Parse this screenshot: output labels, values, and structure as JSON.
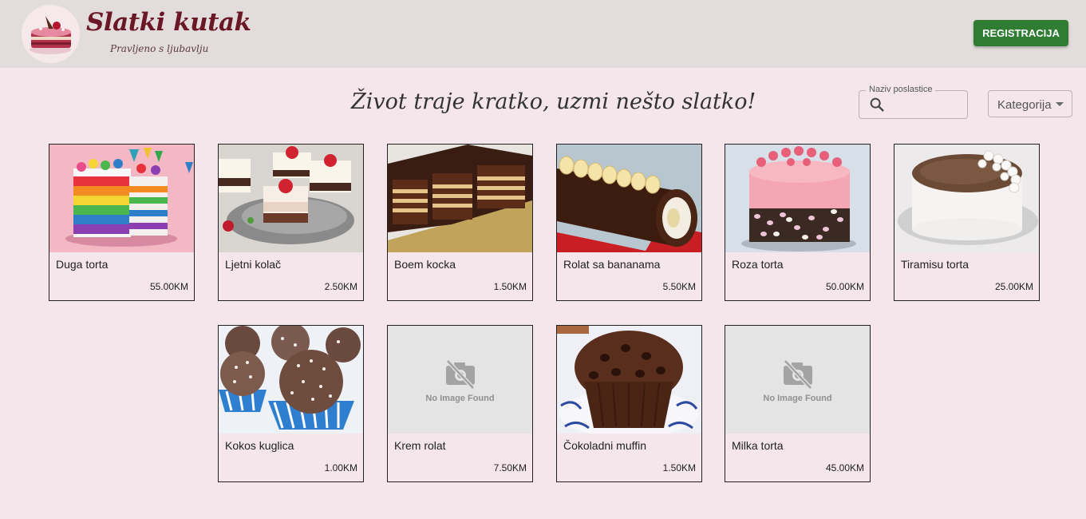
{
  "header": {
    "brand": "Slatki kutak",
    "tagline": "Pravljeno s ljubavlju",
    "register_label": "REGISTRACIJA",
    "accent": "#2e7d32",
    "background": "#e3dcdc"
  },
  "main": {
    "headline": "Život traje kratko, uzmi nešto slatko!",
    "search": {
      "legend": "Naziv poslastice",
      "placeholder": "",
      "value": ""
    },
    "category": {
      "label": "Kategorija"
    }
  },
  "products": [
    {
      "name": "Duga torta",
      "price": "55.00KM",
      "image": "rainbow-cake"
    },
    {
      "name": "Ljetni kolač",
      "price": "2.50KM",
      "image": "summer-cake-slices"
    },
    {
      "name": "Boem kocka",
      "price": "1.50KM",
      "image": "chocolate-layer-bars"
    },
    {
      "name": "Rolat sa bananama",
      "price": "5.50KM",
      "image": "banana-roll"
    },
    {
      "name": "Roza torta",
      "price": "50.00KM",
      "image": "pink-cake"
    },
    {
      "name": "Tiramisu torta",
      "price": "25.00KM",
      "image": "tiramisu-cake"
    },
    {
      "name": "Kokos kuglica",
      "price": "1.00KM",
      "image": "coconut-balls"
    },
    {
      "name": "Krem rolat",
      "price": "7.50KM",
      "image": "no-image",
      "placeholder_text": "No Image Found"
    },
    {
      "name": "Čokoladni muffin",
      "price": "1.50KM",
      "image": "chocolate-muffin"
    },
    {
      "name": "Milka torta",
      "price": "45.00KM",
      "image": "no-image",
      "placeholder_text": "No Image Found"
    }
  ]
}
